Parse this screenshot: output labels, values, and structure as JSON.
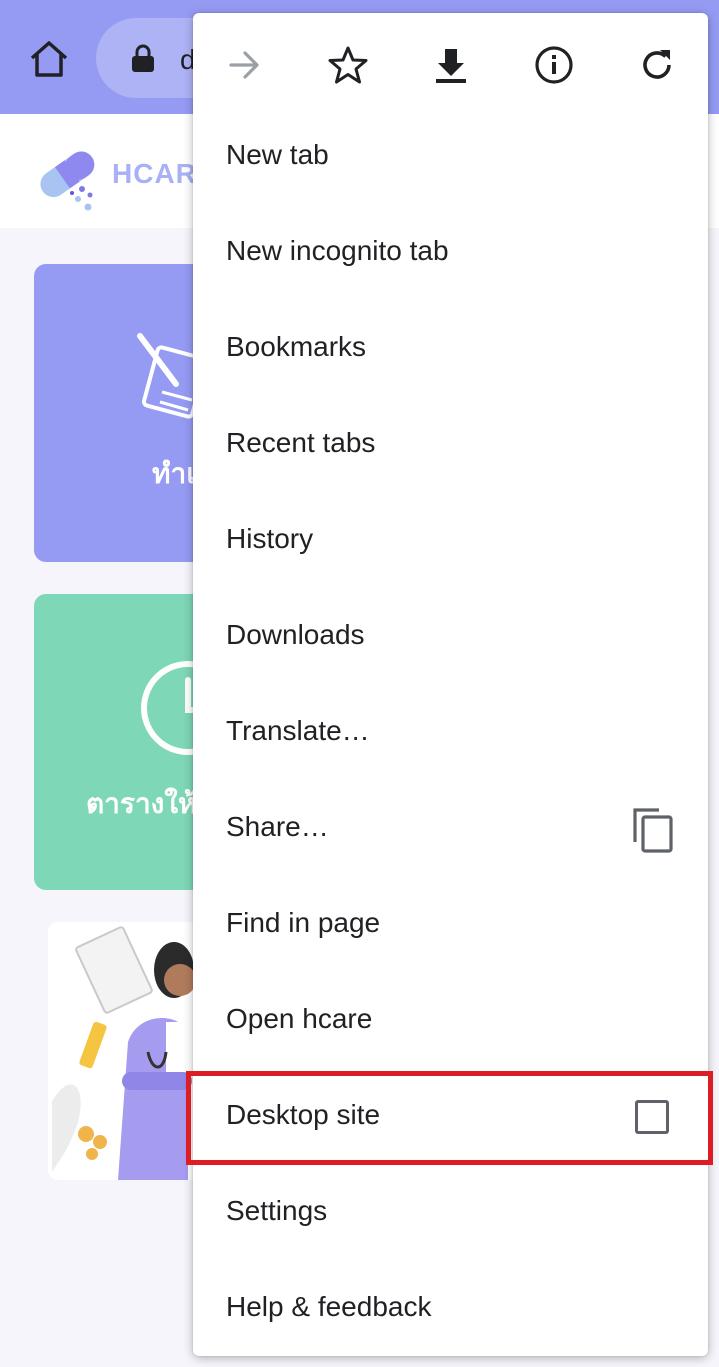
{
  "toolbar": {
    "url_text": "d",
    "colors": {
      "toolbar_bg": "#959bf3",
      "pill_bg": "#aeb3f6"
    },
    "icons": [
      "home-icon",
      "lock-icon"
    ]
  },
  "site": {
    "brand": "HCAR",
    "card_blue_label": "ทำแ",
    "card_green_label": "ตารางให้",
    "colors": {
      "blue_card": "#959bf3",
      "green_card": "#7ed7b7"
    }
  },
  "menu": {
    "top_icons": [
      "forward-icon",
      "bookmark-star-icon",
      "download-icon",
      "info-icon",
      "reload-icon"
    ],
    "items": [
      {
        "label": "New tab"
      },
      {
        "label": "New incognito tab"
      },
      {
        "label": "Bookmarks"
      },
      {
        "label": "Recent tabs"
      },
      {
        "label": "History"
      },
      {
        "label": "Downloads"
      },
      {
        "label": "Translate…"
      },
      {
        "label": "Share…",
        "icon": "copy-share-icon"
      },
      {
        "label": "Find in page"
      },
      {
        "label": "Open hcare"
      },
      {
        "label": "Desktop site",
        "checked": false
      },
      {
        "label": "Settings"
      },
      {
        "label": "Help & feedback"
      }
    ],
    "highlight_color": "#dd1c24"
  }
}
